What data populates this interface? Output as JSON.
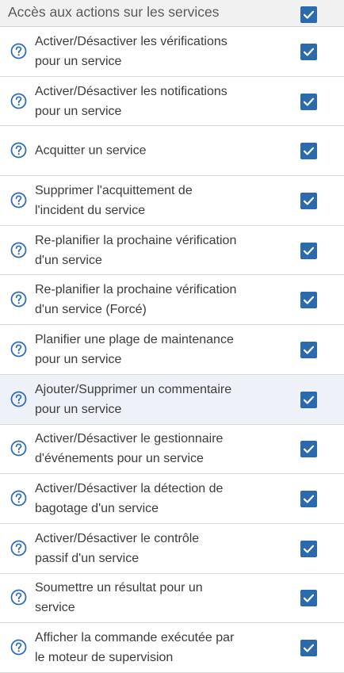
{
  "header": {
    "title": "Accès aux actions sur les services",
    "checked": true
  },
  "rows": [
    {
      "label_line1": "Activer/Désactiver les vérifications",
      "label_line2": "pour un service",
      "checked": true,
      "help_icon": "question-circle-icon"
    },
    {
      "label_line1": "Activer/Désactiver les notifications",
      "label_line2": "pour un service",
      "checked": true,
      "help_icon": "question-circle-icon"
    },
    {
      "label_line1": "Acquitter un service",
      "label_line2": "",
      "checked": true,
      "help_icon": "question-circle-icon"
    },
    {
      "label_line1": "Supprimer l'acquittement de",
      "label_line2": "l'incident du service",
      "checked": true,
      "help_icon": "question-circle-icon"
    },
    {
      "label_line1": "Re-planifier la prochaine vérification",
      "label_line2": "d'un service",
      "checked": true,
      "help_icon": "question-circle-icon"
    },
    {
      "label_line1": "Re-planifier la prochaine vérification",
      "label_line2": "d'un service (Forcé)",
      "checked": true,
      "help_icon": "question-circle-icon"
    },
    {
      "label_line1": "Planifier une plage de maintenance",
      "label_line2": "pour un service",
      "checked": true,
      "help_icon": "question-circle-icon"
    },
    {
      "label_line1": "Ajouter/Supprimer un commentaire",
      "label_line2": "pour un service",
      "checked": true,
      "help_icon": "question-circle-icon",
      "highlighted": true
    },
    {
      "label_line1": "Activer/Désactiver le gestionnaire",
      "label_line2": "d'événements pour un service",
      "checked": true,
      "help_icon": "question-circle-icon"
    },
    {
      "label_line1": "Activer/Désactiver la détection de",
      "label_line2": "bagotage d'un service",
      "checked": true,
      "help_icon": "question-circle-icon"
    },
    {
      "label_line1": "Activer/Désactiver le contrôle",
      "label_line2": "passif d'un service",
      "checked": true,
      "help_icon": "question-circle-icon"
    },
    {
      "label_line1": "Soumettre un résultat pour un",
      "label_line2": "service",
      "checked": true,
      "help_icon": "question-circle-icon"
    },
    {
      "label_line1": "Afficher la commande exécutée par",
      "label_line2": "le moteur de supervision",
      "checked": true,
      "help_icon": "question-circle-icon"
    }
  ],
  "colors": {
    "checkbox": "#2b6aad",
    "help_icon": "#2f6db5",
    "highlight_row": "#eef1f8",
    "header_bg": "#f1f1f1"
  }
}
